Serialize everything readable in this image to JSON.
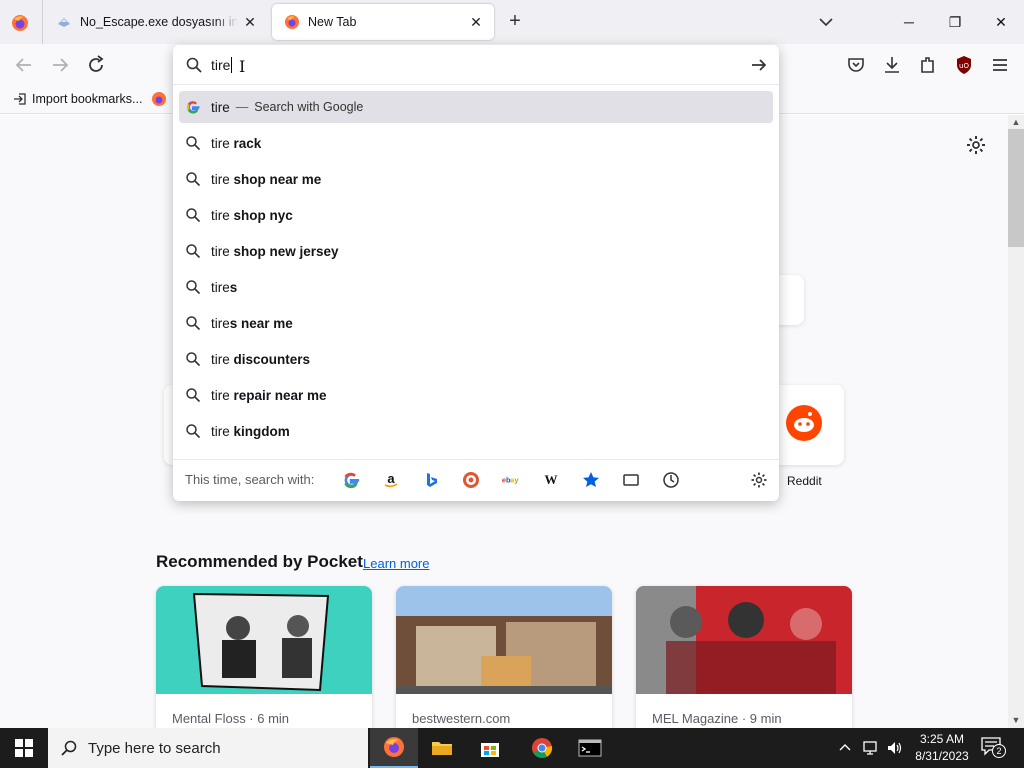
{
  "tabs": [
    {
      "title": "No_Escape.exe dosyasını indir",
      "active": false
    },
    {
      "title": "New Tab",
      "active": true
    }
  ],
  "window_controls": {
    "minimize": "─",
    "restore": "❐",
    "close": "✕"
  },
  "bookmarks": {
    "import_label": "Import bookmarks..."
  },
  "urlbar": {
    "typed": "tire",
    "top_suggestion": {
      "text": "tire",
      "separator": "—",
      "action": "Search with Google"
    },
    "suggestions": [
      {
        "prefix": "tire ",
        "bold": "rack"
      },
      {
        "prefix": "tire ",
        "bold": "shop near me"
      },
      {
        "prefix": "tire ",
        "bold": "shop nyc"
      },
      {
        "prefix": "tire ",
        "bold": "shop new jersey"
      },
      {
        "prefix": "tire",
        "bold": "s"
      },
      {
        "prefix": "tire",
        "bold": "s near me"
      },
      {
        "prefix": "tire ",
        "bold": "discounters"
      },
      {
        "prefix": "tire ",
        "bold": "repair near me"
      },
      {
        "prefix": "tire ",
        "bold": "kingdom"
      }
    ],
    "oneoff_label": "This time, search with:",
    "engines": [
      "google",
      "amazon",
      "bing",
      "duckduckgo",
      "ebay",
      "wikipedia",
      "bookmarks",
      "tabs",
      "history"
    ]
  },
  "topsites": {
    "reddit_label": "Reddit"
  },
  "pocket": {
    "title": "Recommended by Pocket",
    "learn_more": "Learn more",
    "cards": [
      {
        "source": "Mental Floss · 6 min"
      },
      {
        "source": "bestwestern.com"
      },
      {
        "source": "MEL Magazine · 9 min"
      }
    ]
  },
  "taskbar": {
    "search_placeholder": "Type here to search",
    "time": "3:25 AM",
    "date": "8/31/2023",
    "notification_count": "2"
  },
  "colors": {
    "accent": "#0061e0",
    "reddit": "#ff4500",
    "pocket_card1": "#3fd1c0",
    "pocket_card3": "#c8252c"
  }
}
